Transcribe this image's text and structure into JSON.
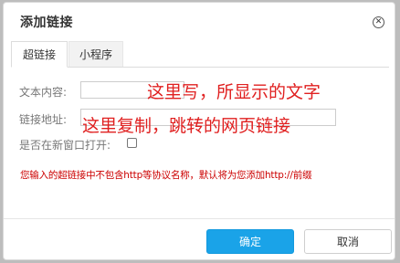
{
  "dialog": {
    "title": "添加链接",
    "close_glyph": "✕"
  },
  "tabs": [
    {
      "label": "超链接",
      "active": true
    },
    {
      "label": "小程序",
      "active": false
    }
  ],
  "form": {
    "text_label": "文本内容:",
    "text_value": "",
    "link_label": "链接地址:",
    "link_value": "",
    "newwin_label": "是否在新窗口打开:",
    "newwin_checked": false,
    "hint": "您输入的超链接中不包含http等协议名称，默认将为您添加http://前缀"
  },
  "annotations": {
    "text_note": "这里写，所显示的文字",
    "link_note": "这里复制，跳转的网页链接",
    "color": "#e02020"
  },
  "buttons": {
    "ok_label": "确定",
    "cancel_label": "取消"
  },
  "colors": {
    "primary": "#1aa3e8",
    "hint": "#cc0000"
  }
}
